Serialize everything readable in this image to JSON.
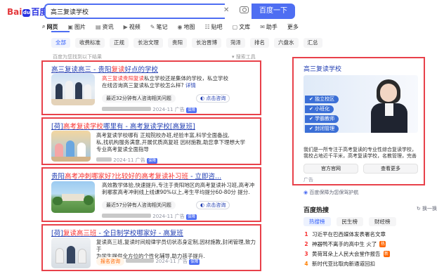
{
  "logo": {
    "left": "Bai",
    "paw": "du",
    "right": "百度"
  },
  "search": {
    "query": "高三复读学校",
    "clear": "✕",
    "button": "百度一下"
  },
  "tabs": [
    {
      "icon": "⌕",
      "label": "网页"
    },
    {
      "icon": "▣",
      "label": "图片"
    },
    {
      "icon": "▤",
      "label": "资讯"
    },
    {
      "icon": "▶",
      "label": "视频"
    },
    {
      "icon": "✎",
      "label": "笔记"
    },
    {
      "icon": "◉",
      "label": "地图"
    },
    {
      "icon": "☷",
      "label": "贴吧"
    },
    {
      "icon": "▢",
      "label": "文库"
    },
    {
      "icon": "✉",
      "label": "助手"
    },
    {
      "icon": "",
      "label": "更多"
    }
  ],
  "filters": [
    "全部",
    "收费标准",
    "正规",
    "长治文理",
    "贵阳",
    "长治晋博",
    "菏泽",
    "排名",
    "六盘水",
    "汇总"
  ],
  "hint": "百度为您找到以下结果",
  "tool": "搜索工具",
  "results": [
    {
      "title_pre": "高三复读",
      "title_mid": "高三 - 贵阳",
      "title_hl": "复读",
      "title_post": "好点的学校",
      "desc1_a": "高三复读",
      "desc1_b": "贵阳复读",
      "desc1_c": "私立学校还是集体的学校，私立学校",
      "desc2": "在线咨询高三复读私立学校怎么样?",
      "desc2_tail": "详情",
      "pill": "最近32分钟有人咨询相关问题",
      "consult": "点击咨询",
      "date": "2024-11",
      "ad": "广告",
      "badge": "保障"
    },
    {
      "title_pre": "[荷]",
      "title_hl": "高考复读学校",
      "title_mid": "哪里有 - 高考复读学校",
      "title_post": "[高复班]",
      "desc1": "高考复读学校哪有 正规院校办班,经验丰富,科学全面备战,",
      "desc2": "私,找机构服务满意,开展优质高复班 因材施教,助您拿下理想大学",
      "desc3": "专业高考复读全面指导",
      "date": "2024-11",
      "ad": "广告",
      "badge": "保障"
    },
    {
      "title_pre": "贵阳",
      "title_hl": "高考冲刺哪家好?比较好的高考复读补习班",
      "title_post": " - 立即咨...",
      "desc1": "高效教学体验,快速提升,专注于贵阳地区的高考复读补习班,高考冲",
      "desc2": "刺哪家高考冲刺线上线课90%以上,考生平均提分60-80分 提分.",
      "pill": "最近57分钟有人咨询相关问题",
      "consult": "点击咨询",
      "date": "2024-11",
      "ad": "广告",
      "badge": "保障"
    },
    {
      "title_pre": "[荷]",
      "title_hl": "复读高三班",
      "title_mid": " - 全日制学校",
      "title_post": "哪家好 - 高复班",
      "desc1": "复读高三班,复读时间规律学员切状态身定制,因材施教,封闭管理,致力于",
      "desc2": "为学生提供全方位的个性化辅导,助力孩子提升.",
      "chip": "报名咨询",
      "date": "2024-11",
      "ad": "广告",
      "badge": "保障"
    }
  ],
  "panel": {
    "title": "高三复读学校",
    "features": [
      "独立校区",
      "小班化",
      "学霸教师",
      "封闭管理"
    ],
    "desc": "我们是一所专注于高考复读的专业性综合复读学校，我校占地近千平米，高考复读学校，名教管理，完善的复读体系...",
    "btn1": "官方官网",
    "btn2": "查看更多",
    "ad": "广告"
  },
  "guarantee": "百度保障为您保驾护航",
  "hot": {
    "title": "百度热搜",
    "refresh": "换一换",
    "tabs": [
      "热搜榜",
      "民生榜",
      "财经榜"
    ],
    "items": [
      {
        "rank": "1",
        "text": "习近平在巴西媒体发表署名文章",
        "tag": ""
      },
      {
        "rank": "2",
        "text": "神器鸭不离手的高中生 火了",
        "tag": "热"
      },
      {
        "rank": "3",
        "text": "黄荷耳朵上人民大会堂作报告",
        "tag": "新"
      },
      {
        "rank": "4",
        "text": "新时代亚比取肉新通道回扣",
        "tag": ""
      }
    ]
  },
  "colors": {
    "accent": "#4e6ef2",
    "highlight_border": "#e8414a",
    "link": "#2440b3",
    "red_text": "#f73131"
  }
}
